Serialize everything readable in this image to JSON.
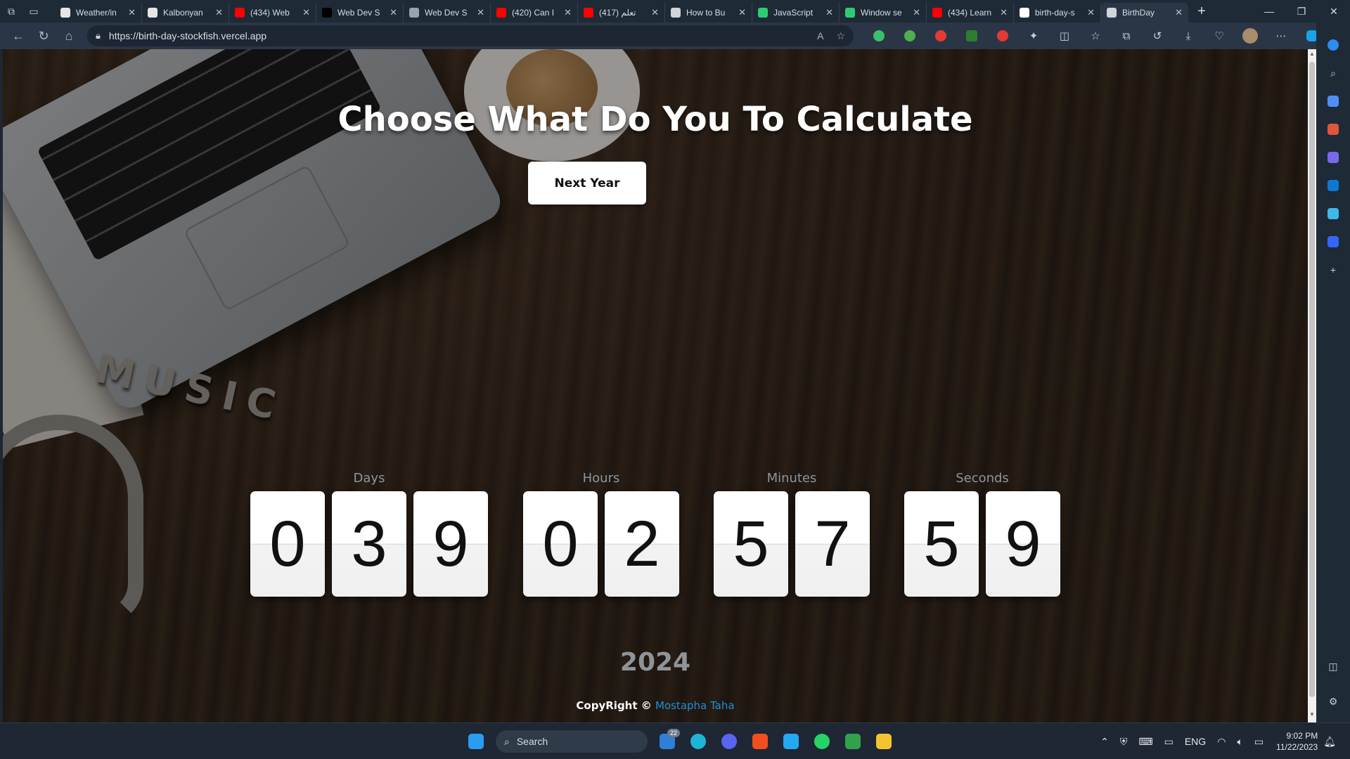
{
  "browser": {
    "tabs": [
      {
        "title": "Weather/in",
        "favicon_color": "#e6e6e6",
        "icon": "github-icon"
      },
      {
        "title": "Kalbonyan",
        "favicon_color": "#e6e6e6",
        "icon": "github-icon"
      },
      {
        "title": "(434) Web",
        "favicon_color": "#ff0000",
        "icon": "youtube-icon"
      },
      {
        "title": "Web Dev S",
        "favicon_color": "#000000",
        "icon": "x-icon"
      },
      {
        "title": "Web Dev S",
        "favicon_color": "#9aa3ad",
        "icon": "page-icon"
      },
      {
        "title": "(420) Can I",
        "favicon_color": "#ff0000",
        "icon": "youtube-icon"
      },
      {
        "title": "تعلم (417)",
        "favicon_color": "#ff0000",
        "icon": "youtube-icon"
      },
      {
        "title": "How to Bu",
        "favicon_color": "#cfd5db",
        "icon": "discord-icon"
      },
      {
        "title": "JavaScript",
        "favicon_color": "#2ecc71",
        "icon": "w3-icon"
      },
      {
        "title": "Window se",
        "favicon_color": "#2ecc71",
        "icon": "w3-icon"
      },
      {
        "title": "(434) Learn",
        "favicon_color": "#ff0000",
        "icon": "youtube-icon"
      },
      {
        "title": "birth-day-s",
        "favicon_color": "#ffffff",
        "icon": "vercel-icon"
      },
      {
        "title": "BirthDay",
        "favicon_color": "#cfd5db",
        "icon": "page-icon",
        "active": true
      }
    ],
    "url": "https://birth-day-stockfish.vercel.app"
  },
  "page": {
    "title": "Choose What Do You To Calculate",
    "button_label": "Next Year",
    "countdown": {
      "days": {
        "label": "Days",
        "digits": [
          "0",
          "3",
          "9"
        ]
      },
      "hours": {
        "label": "Hours",
        "digits": [
          "0",
          "2"
        ]
      },
      "minutes": {
        "label": "Minutes",
        "digits": [
          "5",
          "7"
        ]
      },
      "seconds": {
        "label": "Seconds",
        "digits": [
          "5",
          "9"
        ]
      }
    },
    "year": "2024",
    "footer_prefix": "CopyRight ©",
    "footer_author": "Mostapha Taha",
    "decor_word": "MUSIC"
  },
  "taskbar": {
    "search_placeholder": "Search",
    "mail_badge": "22",
    "language": "ENG",
    "time": "9:02 PM",
    "date": "11/22/2023"
  },
  "colors": {
    "accent_link": "#1f8fd6",
    "digit_card": "#ffffff",
    "label_gray": "#8f9499"
  }
}
